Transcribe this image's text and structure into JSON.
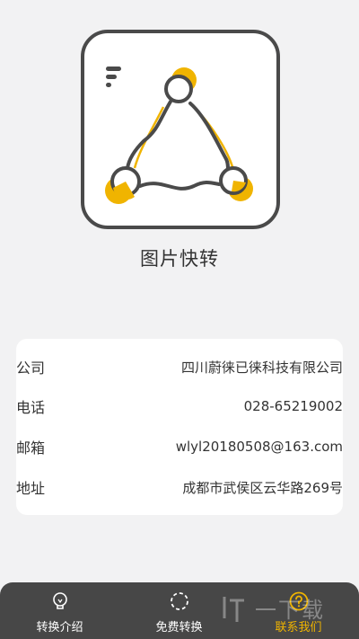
{
  "app": {
    "name": "图片快转"
  },
  "colors": {
    "accent": "#f0b400",
    "dark": "#474747",
    "background": "#f2f2f3"
  },
  "contact": {
    "company": {
      "label": "公司",
      "value": "四川蔚徕已徕科技有限公司"
    },
    "phone": {
      "label": "电话",
      "value": "028-65219002"
    },
    "email": {
      "label": "邮箱",
      "value": "wlyl20180508@163.com"
    },
    "address": {
      "label": "地址",
      "value": "成都市武侯区云华路269号"
    }
  },
  "tabbar": {
    "tabs": [
      {
        "label": "转换介绍",
        "icon": "lightbulb-icon",
        "active": false
      },
      {
        "label": "免费转换",
        "icon": "refresh-circle-icon",
        "active": false
      },
      {
        "label": "联系我们",
        "icon": "question-circle-icon",
        "active": true
      }
    ]
  },
  "watermark": {
    "text": "一下载"
  }
}
